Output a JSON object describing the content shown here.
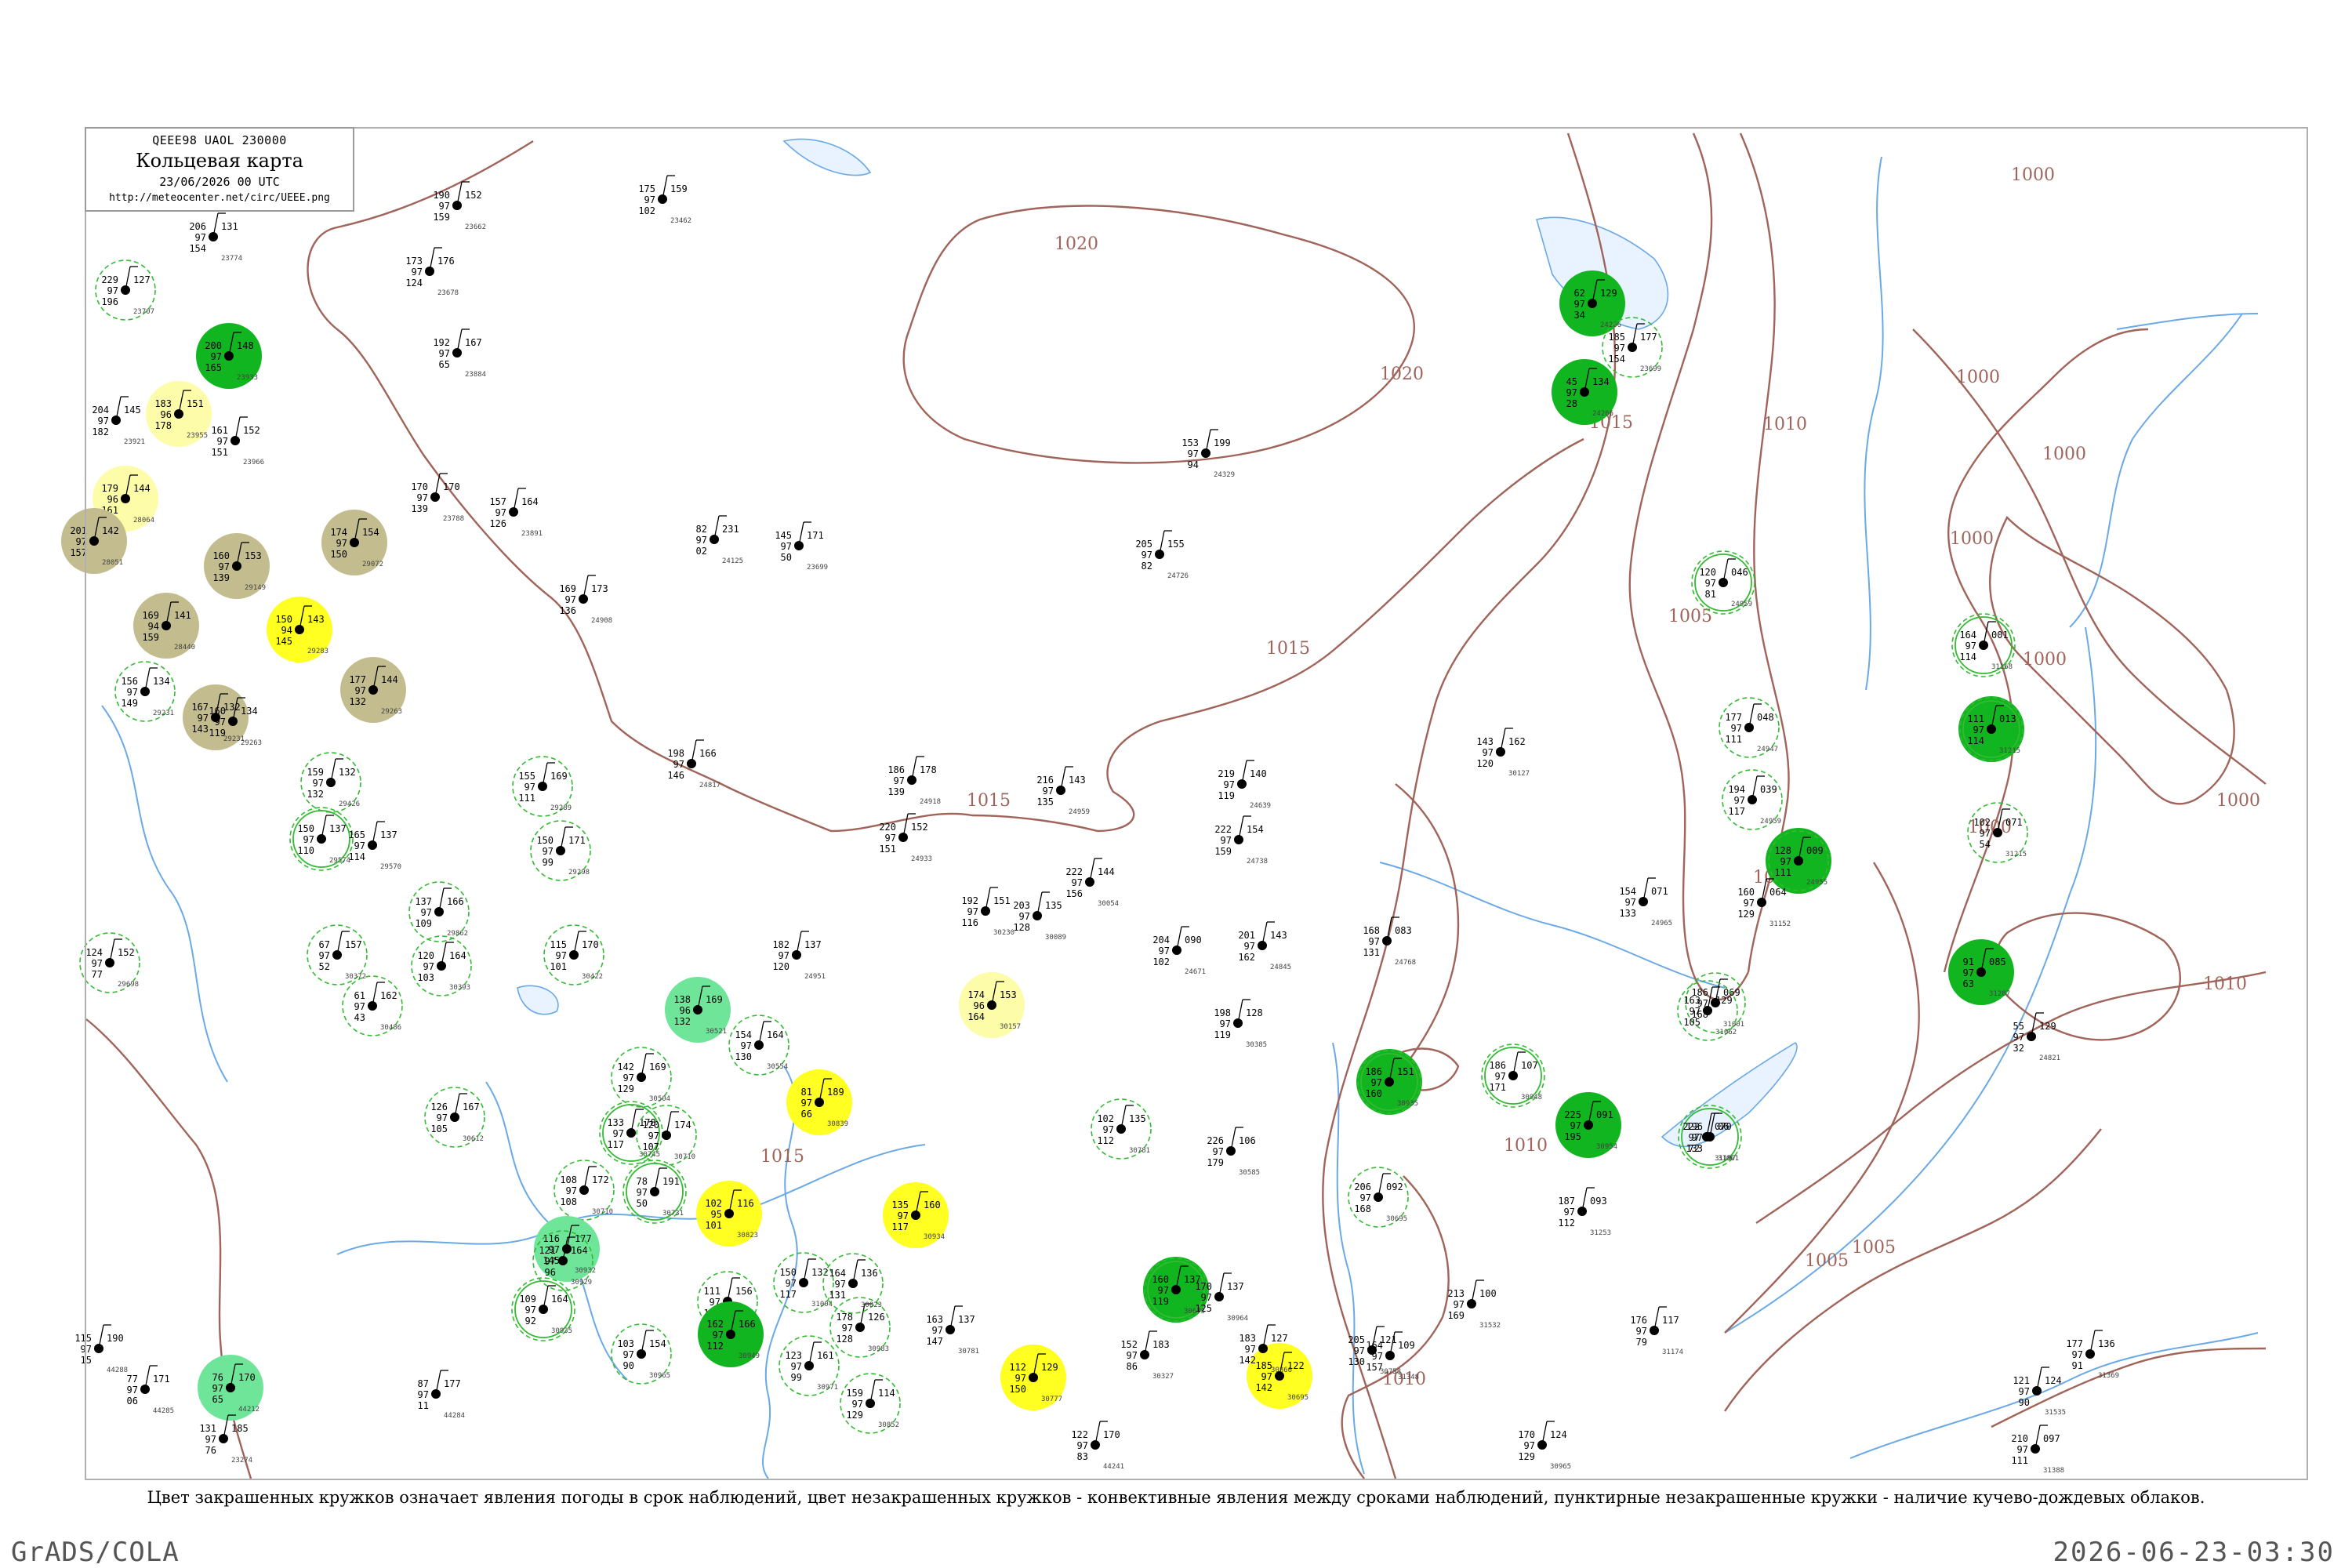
{
  "title_box": {
    "header": "QEEE98  UAOL  230000",
    "title": "Кольцевая карта",
    "date": "23/06/2026 00 UTC",
    "url": "http://meteocenter.net/circ/UEEE.png"
  },
  "caption": "Цвет закрашенных кружков означает явления погоды в срок наблюдений, цвет незакрашенных кружков - конвективные явления между сроками наблюдений, пунктирные незакрашенные кружки - наличие кучево-дождевых облаков.",
  "footer": {
    "left": "GrADS/COLA",
    "right": "2026-06-23-03:30"
  },
  "colors": {
    "isobar": "#a0645a",
    "river": "#6aa9e6",
    "ring": "#33bb33",
    "dark_green": "#11b51f",
    "light_green": "#6fe59a",
    "yellow": "#ffff22",
    "pale_yellow": "#fdfca8",
    "olive": "#c3bc8e"
  },
  "isobars": [
    {
      "label": "1020"
    },
    {
      "label": "1020"
    },
    {
      "label": "1015"
    },
    {
      "label": "1015"
    },
    {
      "label": "1015"
    },
    {
      "label": "1015"
    },
    {
      "label": "1010"
    },
    {
      "label": "1010"
    },
    {
      "label": "1010"
    },
    {
      "label": "1005"
    },
    {
      "label": "1005"
    },
    {
      "label": "1005"
    },
    {
      "label": "1005"
    },
    {
      "label": "1000"
    },
    {
      "label": "1000"
    },
    {
      "label": "1000"
    },
    {
      "label": "1000"
    },
    {
      "label": "1000"
    },
    {
      "label": "1000"
    },
    {
      "label": "1010"
    },
    {
      "label": "1000"
    }
  ],
  "stations": [
    {
      "t": "229",
      "p": "127",
      "d": "97",
      "v": "196",
      "id": "23707",
      "fill": "none",
      "ring": "dash"
    },
    {
      "t": "206",
      "p": "131",
      "d": "97",
      "v": "154",
      "id": "23774",
      "fill": "none",
      "ring": "none"
    },
    {
      "t": "200",
      "p": "148",
      "d": "97",
      "v": "165",
      "id": "23933",
      "fill": "dark_green",
      "ring": "none"
    },
    {
      "t": "204",
      "p": "145",
      "d": "97",
      "v": "182",
      "id": "23921",
      "fill": "none",
      "ring": "none"
    },
    {
      "t": "183",
      "p": "151",
      "d": "96",
      "v": "178",
      "id": "23955",
      "fill": "pale_yellow",
      "ring": "none"
    },
    {
      "t": "161",
      "p": "152",
      "d": "97",
      "v": "151",
      "id": "23966",
      "fill": "none",
      "ring": "none"
    },
    {
      "t": "179",
      "p": "144",
      "d": "96",
      "v": "161",
      "id": "28064",
      "fill": "pale_yellow",
      "ring": "none"
    },
    {
      "t": "201",
      "p": "142",
      "d": "97",
      "v": "157",
      "id": "28051",
      "fill": "olive",
      "ring": "none"
    },
    {
      "t": "160",
      "p": "153",
      "d": "97",
      "v": "139",
      "id": "29149",
      "fill": "olive",
      "ring": "none"
    },
    {
      "t": "174",
      "p": "154",
      "d": "97",
      "v": "150",
      "id": "29072",
      "fill": "olive",
      "ring": "none"
    },
    {
      "t": "169",
      "p": "141",
      "d": "94",
      "v": "159",
      "id": "28440",
      "fill": "olive",
      "ring": "none"
    },
    {
      "t": "150",
      "p": "143",
      "d": "94",
      "v": "145",
      "id": "29283",
      "fill": "yellow",
      "ring": "none"
    },
    {
      "t": "177",
      "p": "144",
      "d": "97",
      "v": "132",
      "id": "29263",
      "fill": "olive",
      "ring": "none"
    },
    {
      "t": "167",
      "p": "132",
      "d": "97",
      "v": "143",
      "id": "29231",
      "fill": "olive",
      "ring": "none"
    },
    {
      "t": "156",
      "p": "134",
      "d": "97",
      "v": "149",
      "id": "29231",
      "fill": "none",
      "ring": "dash"
    },
    {
      "t": "160",
      "p": "134",
      "d": "97",
      "v": "119",
      "id": "29263",
      "fill": "none",
      "ring": "none"
    },
    {
      "t": "159",
      "p": "132",
      "d": "97",
      "v": "132",
      "id": "29426",
      "fill": "none",
      "ring": "dash"
    },
    {
      "t": "150",
      "p": "137",
      "d": "97",
      "v": "110",
      "id": "29574",
      "fill": "none",
      "ring": "solid"
    },
    {
      "t": "165",
      "p": "137",
      "d": "97",
      "v": "114",
      "id": "29570",
      "fill": "none",
      "ring": "none"
    },
    {
      "t": "137",
      "p": "166",
      "d": "97",
      "v": "109",
      "id": "29862",
      "fill": "none",
      "ring": "dash"
    },
    {
      "t": "155",
      "p": "169",
      "d": "97",
      "v": "111",
      "id": "29289",
      "fill": "none",
      "ring": "dash"
    },
    {
      "t": "150",
      "p": "171",
      "d": "97",
      "v": "99",
      "id": "29298",
      "fill": "none",
      "ring": "dash"
    },
    {
      "t": "115",
      "p": "170",
      "d": "97",
      "v": "101",
      "id": "30422",
      "fill": "none",
      "ring": "dash"
    },
    {
      "t": "120",
      "p": "164",
      "d": "97",
      "v": "103",
      "id": "30393",
      "fill": "none",
      "ring": "dash"
    },
    {
      "t": "67",
      "p": "157",
      "d": "97",
      "v": "52",
      "id": "30372",
      "fill": "none",
      "ring": "dash"
    },
    {
      "t": "61",
      "p": "162",
      "d": "97",
      "v": "43",
      "id": "30486",
      "fill": "none",
      "ring": "dash"
    },
    {
      "t": "124",
      "p": "152",
      "d": "97",
      "v": "77",
      "id": "29698",
      "fill": "none",
      "ring": "dash"
    },
    {
      "t": "138",
      "p": "169",
      "d": "96",
      "v": "132",
      "id": "30521",
      "fill": "light_green",
      "ring": "none"
    },
    {
      "t": "154",
      "p": "164",
      "d": "97",
      "v": "130",
      "id": "30554",
      "fill": "none",
      "ring": "dash"
    },
    {
      "t": "142",
      "p": "169",
      "d": "97",
      "v": "129",
      "id": "30504",
      "fill": "none",
      "ring": "dash"
    },
    {
      "t": "133",
      "p": "178",
      "d": "97",
      "v": "117",
      "id": "30745",
      "fill": "none",
      "ring": "solid"
    },
    {
      "t": "108",
      "p": "172",
      "d": "97",
      "v": "108",
      "id": "30710",
      "fill": "none",
      "ring": "dash"
    },
    {
      "t": "126",
      "p": "167",
      "d": "97",
      "v": "105",
      "id": "30612",
      "fill": "none",
      "ring": "dash"
    },
    {
      "t": "81",
      "p": "189",
      "d": "97",
      "v": "66",
      "id": "30839",
      "fill": "yellow",
      "ring": "none"
    },
    {
      "t": "120",
      "p": "174",
      "d": "97",
      "v": "107",
      "id": "30710",
      "fill": "none",
      "ring": "dash"
    },
    {
      "t": "116",
      "p": "177",
      "d": "97",
      "v": "145",
      "id": "30932",
      "fill": "light_green",
      "ring": "none"
    },
    {
      "t": "102",
      "p": "116",
      "d": "95",
      "v": "101",
      "id": "30823",
      "fill": "yellow",
      "ring": "none"
    },
    {
      "t": "78",
      "p": "191",
      "d": "97",
      "v": "50",
      "id": "30731",
      "fill": "none",
      "ring": "solid"
    },
    {
      "t": "121",
      "p": "164",
      "d": "97",
      "v": "96",
      "id": "30929",
      "fill": "none",
      "ring": "dash"
    },
    {
      "t": "109",
      "p": "164",
      "d": "97",
      "v": "92",
      "id": "30935",
      "fill": "none",
      "ring": "solid"
    },
    {
      "t": "103",
      "p": "154",
      "d": "97",
      "v": "90",
      "id": "30965",
      "fill": "none",
      "ring": "dash"
    },
    {
      "t": "111",
      "p": "156",
      "d": "97",
      "v": "103",
      "id": "30936",
      "fill": "none",
      "ring": "dash"
    },
    {
      "t": "162",
      "p": "166",
      "d": "97",
      "v": "112",
      "id": "30949",
      "fill": "dark_green",
      "ring": "none"
    },
    {
      "t": "150",
      "p": "132",
      "d": "97",
      "v": "117",
      "id": "31004",
      "fill": "none",
      "ring": "dash"
    },
    {
      "t": "123",
      "p": "161",
      "d": "97",
      "v": "99",
      "id": "30971",
      "fill": "none",
      "ring": "dash"
    },
    {
      "t": "178",
      "p": "126",
      "d": "97",
      "v": "128",
      "id": "30983",
      "fill": "none",
      "ring": "dash"
    },
    {
      "t": "164",
      "p": "136",
      "d": "97",
      "v": "131",
      "id": "30823",
      "fill": "none",
      "ring": "dash"
    },
    {
      "t": "159",
      "p": "114",
      "d": "97",
      "v": "129",
      "id": "30852",
      "fill": "none",
      "ring": "dash"
    },
    {
      "t": "135",
      "p": "160",
      "d": "97",
      "v": "117",
      "id": "30934",
      "fill": "yellow",
      "ring": "none"
    },
    {
      "t": "112",
      "p": "129",
      "d": "97",
      "v": "150",
      "id": "30777",
      "fill": "yellow",
      "ring": "none"
    },
    {
      "t": "174",
      "p": "153",
      "d": "96",
      "v": "164",
      "id": "30157",
      "fill": "pale_yellow",
      "ring": "none"
    },
    {
      "t": "76",
      "p": "170",
      "d": "97",
      "v": "65",
      "id": "44212",
      "fill": "light_green",
      "ring": "none"
    },
    {
      "t": "160",
      "p": "137",
      "d": "97",
      "v": "119",
      "id": "30673",
      "fill": "dark_green",
      "ring": "solid"
    },
    {
      "t": "102",
      "p": "135",
      "d": "97",
      "v": "112",
      "id": "30781",
      "fill": "none",
      "ring": "dash"
    },
    {
      "t": "185",
      "p": "122",
      "d": "97",
      "v": "142",
      "id": "30695",
      "fill": "yellow",
      "ring": "none"
    },
    {
      "t": "206",
      "p": "092",
      "d": "97",
      "v": "168",
      "id": "30695",
      "fill": "none",
      "ring": "dash"
    },
    {
      "t": "186",
      "p": "151",
      "d": "97",
      "v": "160",
      "id": "30935",
      "fill": "dark_green",
      "ring": "solid"
    },
    {
      "t": "186",
      "p": "107",
      "d": "97",
      "v": "171",
      "id": "30948",
      "fill": "none",
      "ring": "solid"
    },
    {
      "t": "225",
      "p": "091",
      "d": "97",
      "v": "195",
      "id": "30954",
      "fill": "dark_green",
      "ring": "none"
    },
    {
      "t": "196",
      "p": "06",
      "d": "97",
      "v": "133",
      "id": "31061",
      "fill": "none",
      "ring": "solid"
    },
    {
      "t": "186",
      "p": "069",
      "d": "97",
      "v": "168",
      "id": "31001",
      "fill": "none",
      "ring": "dash"
    },
    {
      "t": "163",
      "p": "129",
      "d": "97",
      "v": "105",
      "id": "31062",
      "fill": "none",
      "ring": "dash"
    },
    {
      "t": "120",
      "p": "046",
      "d": "97",
      "v": "81",
      "id": "24959",
      "fill": "none",
      "ring": "solid"
    },
    {
      "t": "177",
      "p": "048",
      "d": "97",
      "v": "111",
      "id": "24947",
      "fill": "none",
      "ring": "dash"
    },
    {
      "t": "194",
      "p": "039",
      "d": "97",
      "v": "117",
      "id": "24959",
      "fill": "none",
      "ring": "dash"
    },
    {
      "t": "128",
      "p": "009",
      "d": "97",
      "v": "111",
      "id": "24955",
      "fill": "dark_green",
      "ring": "dash"
    },
    {
      "t": "164",
      "p": "001",
      "d": "97",
      "v": "114",
      "id": "31168",
      "fill": "none",
      "ring": "solid"
    },
    {
      "t": "111",
      "p": "013",
      "d": "97",
      "v": "114",
      "id": "31215",
      "fill": "dark_green",
      "ring": "solid"
    },
    {
      "t": "102",
      "p": "071",
      "d": "97",
      "v": "54",
      "id": "31215",
      "fill": "none",
      "ring": "dash"
    },
    {
      "t": "91",
      "p": "085",
      "d": "97",
      "v": "63",
      "id": "31287",
      "fill": "dark_green",
      "ring": "none"
    },
    {
      "t": "55",
      "p": "129",
      "d": "97",
      "v": "32",
      "id": "24821",
      "fill": "none",
      "ring": "none"
    },
    {
      "t": "45",
      "p": "134",
      "d": "97",
      "v": "28",
      "id": "24266",
      "fill": "dark_green",
      "ring": "none"
    },
    {
      "t": "62",
      "p": "129",
      "d": "97",
      "v": "34",
      "id": "24266",
      "fill": "dark_green",
      "ring": "none"
    },
    {
      "t": "185",
      "p": "177",
      "d": "97",
      "v": "154",
      "id": "23699",
      "fill": "none",
      "ring": "dash"
    },
    {
      "t": "145",
      "p": "171",
      "d": "97",
      "v": "50",
      "id": "23699",
      "fill": "none",
      "ring": "none"
    },
    {
      "t": "82",
      "p": "231",
      "d": "97",
      "v": "02",
      "id": "24125",
      "fill": "none",
      "ring": "none"
    },
    {
      "t": "153",
      "p": "199",
      "d": "97",
      "v": "94",
      "id": "24329",
      "fill": "none",
      "ring": "none"
    },
    {
      "t": "205",
      "p": "155",
      "d": "97",
      "v": "82",
      "id": "24726",
      "fill": "none",
      "ring": "none"
    },
    {
      "t": "216",
      "p": "143",
      "d": "97",
      "v": "135",
      "id": "24959",
      "fill": "none",
      "ring": "none"
    },
    {
      "t": "201",
      "p": "143",
      "d": "97",
      "v": "162",
      "id": "24845",
      "fill": "none",
      "ring": "none"
    },
    {
      "t": "204",
      "p": "090",
      "d": "97",
      "v": "102",
      "id": "24671",
      "fill": "none",
      "ring": "none"
    },
    {
      "t": "143",
      "p": "162",
      "d": "97",
      "v": "120",
      "id": "30127",
      "fill": "none",
      "ring": "none"
    },
    {
      "t": "192",
      "p": "151",
      "d": "97",
      "v": "116",
      "id": "30230",
      "fill": "none",
      "ring": "none"
    },
    {
      "t": "182",
      "p": "137",
      "d": "97",
      "v": "120",
      "id": "24951",
      "fill": "none",
      "ring": "none"
    },
    {
      "t": "168",
      "p": "083",
      "d": "97",
      "v": "131",
      "id": "24768",
      "fill": "none",
      "ring": "none"
    },
    {
      "t": "154",
      "p": "071",
      "d": "97",
      "v": "133",
      "id": "24965",
      "fill": "none",
      "ring": "none"
    },
    {
      "t": "160",
      "p": "064",
      "d": "97",
      "v": "129",
      "id": "31152",
      "fill": "none",
      "ring": "none"
    },
    {
      "t": "222",
      "p": "070",
      "d": "97",
      "v": "72",
      "id": "31197",
      "fill": "none",
      "ring": "none"
    },
    {
      "t": "187",
      "p": "093",
      "d": "97",
      "v": "112",
      "id": "31253",
      "fill": "none",
      "ring": "none"
    },
    {
      "t": "213",
      "p": "100",
      "d": "97",
      "v": "169",
      "id": "31532",
      "fill": "none",
      "ring": "none"
    },
    {
      "t": "164",
      "p": "109",
      "d": "97",
      "v": "157",
      "id": "31348",
      "fill": "none",
      "ring": "none"
    },
    {
      "t": "176",
      "p": "117",
      "d": "97",
      "v": "79",
      "id": "31174",
      "fill": "none",
      "ring": "none"
    },
    {
      "t": "177",
      "p": "136",
      "d": "97",
      "v": "91",
      "id": "31369",
      "fill": "none",
      "ring": "none"
    },
    {
      "t": "121",
      "p": "124",
      "d": "97",
      "v": "90",
      "id": "31535",
      "fill": "none",
      "ring": "none"
    },
    {
      "t": "210",
      "p": "097",
      "d": "97",
      "v": "111",
      "id": "31388",
      "fill": "none",
      "ring": "none"
    },
    {
      "t": "170",
      "p": "124",
      "d": "97",
      "v": "129",
      "id": "30965",
      "fill": "none",
      "ring": "none"
    },
    {
      "t": "122",
      "p": "170",
      "d": "97",
      "v": "83",
      "id": "44241",
      "fill": "none",
      "ring": "none"
    },
    {
      "t": "87",
      "p": "177",
      "d": "97",
      "v": "11",
      "id": "44284",
      "fill": "none",
      "ring": "none"
    },
    {
      "t": "77",
      "p": "171",
      "d": "97",
      "v": "06",
      "id": "44285",
      "fill": "none",
      "ring": "none"
    },
    {
      "t": "115",
      "p": "190",
      "d": "97",
      "v": "15",
      "id": "44288",
      "fill": "none",
      "ring": "none"
    },
    {
      "t": "131",
      "p": "185",
      "d": "97",
      "v": "76",
      "id": "23274",
      "fill": "none",
      "ring": "none"
    },
    {
      "t": "175",
      "p": "159",
      "d": "97",
      "v": "102",
      "id": "23462",
      "fill": "none",
      "ring": "none"
    },
    {
      "t": "190",
      "p": "152",
      "d": "97",
      "v": "159",
      "id": "23662",
      "fill": "none",
      "ring": "none"
    },
    {
      "t": "173",
      "p": "176",
      "d": "97",
      "v": "124",
      "id": "23678",
      "fill": "none",
      "ring": "none"
    },
    {
      "t": "192",
      "p": "167",
      "d": "97",
      "v": "65",
      "id": "23884",
      "fill": "none",
      "ring": "none"
    },
    {
      "t": "170",
      "p": "170",
      "d": "97",
      "v": "139",
      "id": "23788",
      "fill": "none",
      "ring": "none"
    },
    {
      "t": "157",
      "p": "164",
      "d": "97",
      "v": "126",
      "id": "23891",
      "fill": "none",
      "ring": "none"
    },
    {
      "t": "169",
      "p": "173",
      "d": "97",
      "v": "136",
      "id": "24908",
      "fill": "none",
      "ring": "none"
    },
    {
      "t": "198",
      "p": "166",
      "d": "97",
      "v": "146",
      "id": "24817",
      "fill": "none",
      "ring": "none"
    },
    {
      "t": "186",
      "p": "178",
      "d": "97",
      "v": "139",
      "id": "24918",
      "fill": "none",
      "ring": "none"
    },
    {
      "t": "220",
      "p": "152",
      "d": "97",
      "v": "151",
      "id": "24933",
      "fill": "none",
      "ring": "none"
    },
    {
      "t": "222",
      "p": "144",
      "d": "97",
      "v": "156",
      "id": "30054",
      "fill": "none",
      "ring": "none"
    },
    {
      "t": "219",
      "p": "140",
      "d": "97",
      "v": "119",
      "id": "24639",
      "fill": "none",
      "ring": "none"
    },
    {
      "t": "222",
      "p": "154",
      "d": "97",
      "v": "159",
      "id": "24738",
      "fill": "none",
      "ring": "none"
    },
    {
      "t": "203",
      "p": "135",
      "d": "97",
      "v": "128",
      "id": "30089",
      "fill": "none",
      "ring": "none"
    },
    {
      "t": "198",
      "p": "128",
      "d": "97",
      "v": "119",
      "id": "30385",
      "fill": "none",
      "ring": "none"
    },
    {
      "t": "226",
      "p": "106",
      "d": "97",
      "v": "179",
      "id": "30585",
      "fill": "none",
      "ring": "none"
    },
    {
      "t": "205",
      "p": "121",
      "d": "97",
      "v": "130",
      "id": "30758",
      "fill": "none",
      "ring": "none"
    },
    {
      "t": "170",
      "p": "137",
      "d": "97",
      "v": "125",
      "id": "30964",
      "fill": "none",
      "ring": "none"
    },
    {
      "t": "183",
      "p": "127",
      "d": "97",
      "v": "142",
      "id": "30866",
      "fill": "none",
      "ring": "none"
    },
    {
      "t": "163",
      "p": "137",
      "d": "97",
      "v": "147",
      "id": "30781",
      "fill": "none",
      "ring": "none"
    },
    {
      "t": "152",
      "p": "183",
      "d": "97",
      "v": "86",
      "id": "30327",
      "fill": "none",
      "ring": "none"
    }
  ]
}
